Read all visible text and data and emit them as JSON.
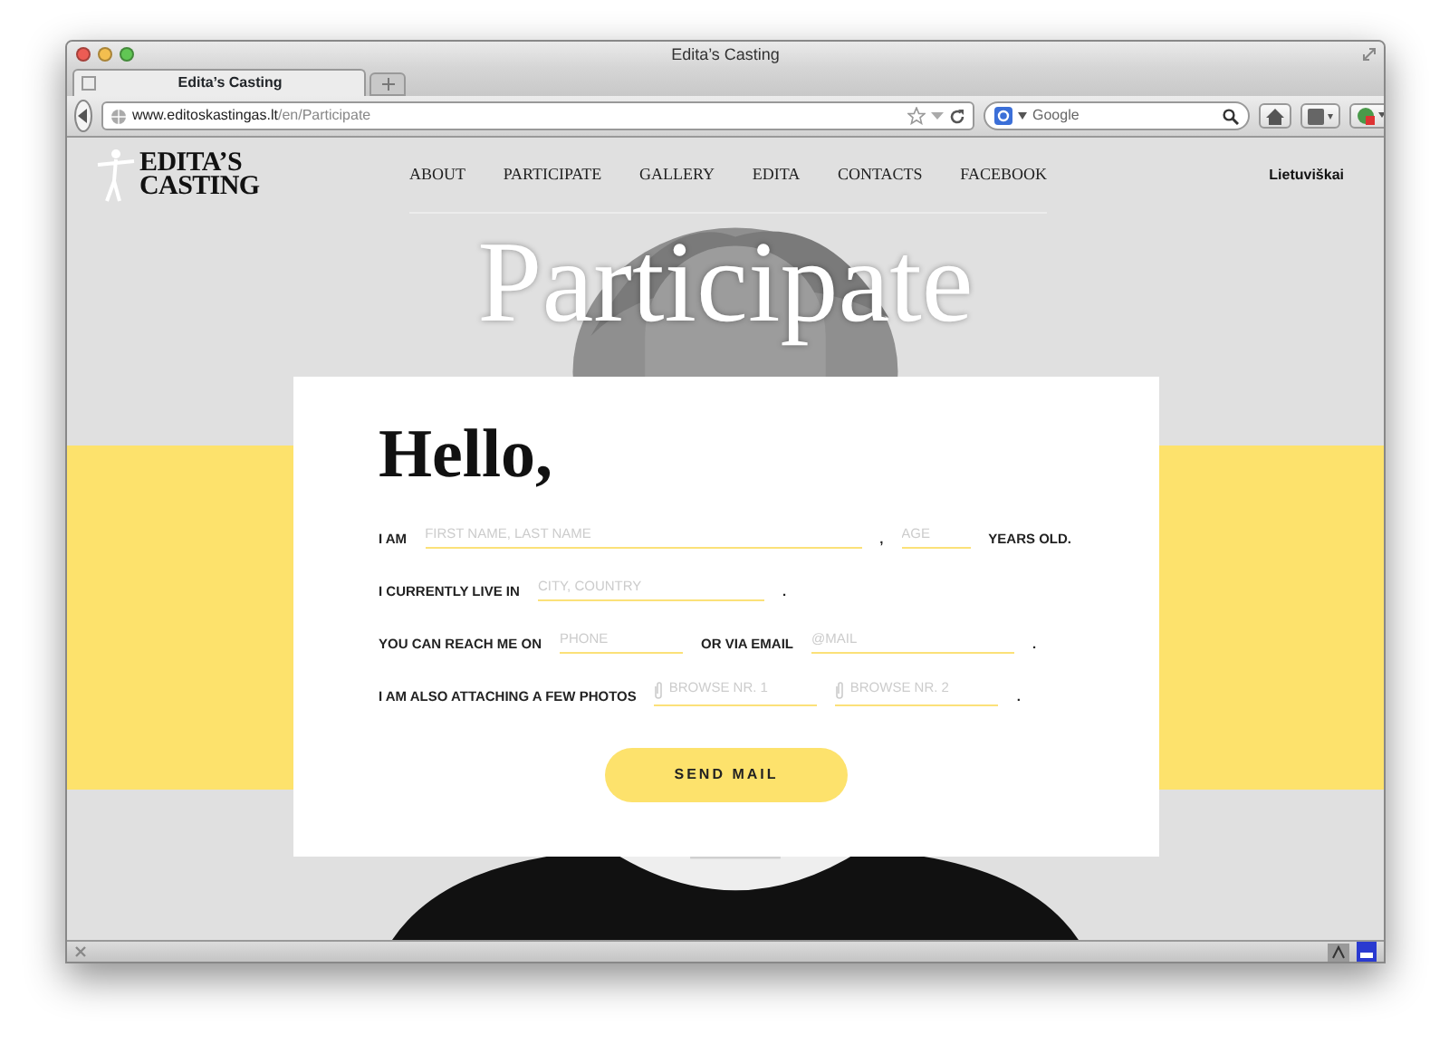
{
  "window": {
    "title": "Edita’s Casting"
  },
  "tabs": [
    {
      "label": "Edita’s Casting",
      "selected": true
    }
  ],
  "toolbar": {
    "url_host": "www.editoskastingas.lt",
    "url_path": "/en/Participate",
    "search_placeholder": "Google"
  },
  "site": {
    "logo": [
      "EDITA’S",
      "CASTING"
    ],
    "nav": [
      {
        "label": "ABOUT",
        "selected": false
      },
      {
        "label": "PARTICIPATE",
        "selected": false
      },
      {
        "label": "GALLERY",
        "selected": false
      },
      {
        "label": "EDITA",
        "selected": false
      },
      {
        "label": "CONTACTS",
        "selected": false
      },
      {
        "label": "FACEBOOK",
        "selected": false
      }
    ],
    "language": "Lietuviškai",
    "heading": "Participate"
  },
  "form": {
    "greeting": "Hello,",
    "rows": [
      [
        {
          "kind": "label",
          "text": "I AM"
        },
        {
          "kind": "field",
          "placeholder": "FIRST NAME, LAST NAME"
        },
        {
          "kind": "label",
          "text": ","
        },
        {
          "kind": "field",
          "placeholder": "AGE"
        },
        {
          "kind": "label",
          "text": "YEARS OLD."
        }
      ],
      [
        {
          "kind": "label",
          "text": "I CURRENTLY LIVE IN"
        },
        {
          "kind": "field",
          "placeholder": "CITY, COUNTRY"
        },
        {
          "kind": "label",
          "text": "."
        }
      ],
      [
        {
          "kind": "label",
          "text": "YOU CAN REACH ME ON"
        },
        {
          "kind": "field",
          "placeholder": "PHONE"
        },
        {
          "kind": "label",
          "text": "OR VIA EMAIL"
        },
        {
          "kind": "field",
          "placeholder": "@MAIL"
        },
        {
          "kind": "label",
          "text": "."
        }
      ],
      [
        {
          "kind": "label",
          "text": "I AM ALSO ATTACHING A FEW PHOTOS"
        },
        {
          "kind": "file",
          "placeholder": "BROWSE NR. 1"
        },
        {
          "kind": "file",
          "placeholder": "BROWSE NR. 2"
        },
        {
          "kind": "label",
          "text": "."
        }
      ]
    ],
    "button": "SEND MAIL"
  }
}
